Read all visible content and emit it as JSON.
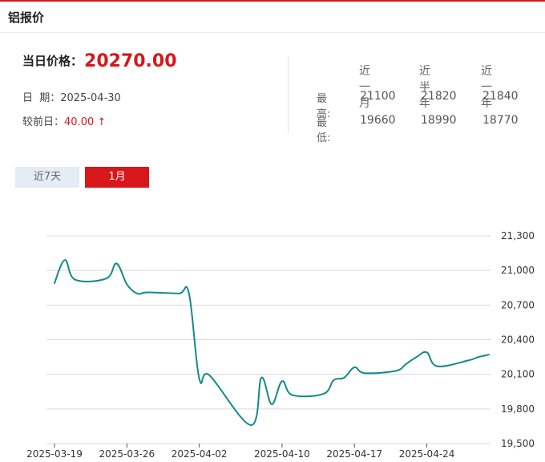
{
  "header": {
    "title": "铝报价"
  },
  "summary": {
    "price_label": "当日价格：",
    "price": "20270.00",
    "date_label": "日  期：",
    "date": "2025-04-30",
    "change_label": "较前日：",
    "change": "40.00 ↑"
  },
  "stats": {
    "columns": [
      "近一月",
      "近半年",
      "近一年"
    ],
    "high_label": "最高:",
    "low_label": "最低:",
    "high": [
      "21100",
      "21820",
      "21840"
    ],
    "low": [
      "19660",
      "18990",
      "18770"
    ]
  },
  "tabs": [
    {
      "label": "近7天",
      "active": false
    },
    {
      "label": "1月",
      "active": true
    }
  ],
  "colors": {
    "accent": "#d7171a",
    "line": "#138a8a",
    "grid": "#d9d9d9"
  },
  "chart_data": {
    "type": "line",
    "title": "",
    "xlabel": "",
    "ylabel": "",
    "ylim": [
      19500,
      21300
    ],
    "y_ticks": [
      19500,
      19800,
      20100,
      20400,
      20700,
      21000,
      21300
    ],
    "y_tick_labels": [
      "19,500",
      "19,800",
      "20,100",
      "20,400",
      "20,700",
      "21,000",
      "21,300"
    ],
    "x_ticks": [
      "2025-03-19",
      "2025-03-26",
      "2025-04-02",
      "2025-04-10",
      "2025-04-17",
      "2025-04-24"
    ],
    "grid": true,
    "legend": "none",
    "x": [
      "2025-03-19",
      "2025-03-20",
      "2025-03-21",
      "2025-03-24",
      "2025-03-25",
      "2025-03-26",
      "2025-03-27",
      "2025-03-28",
      "2025-03-31",
      "2025-04-01",
      "2025-04-02",
      "2025-04-03",
      "2025-04-07",
      "2025-04-08",
      "2025-04-09",
      "2025-04-10",
      "2025-04-11",
      "2025-04-14",
      "2025-04-15",
      "2025-04-16",
      "2025-04-17",
      "2025-04-18",
      "2025-04-21",
      "2025-04-22",
      "2025-04-23",
      "2025-04-24",
      "2025-04-25",
      "2025-04-28",
      "2025-04-29",
      "2025-04-30"
    ],
    "series": [
      {
        "values": [
          20890,
          21090,
          20920,
          20930,
          21060,
          20880,
          20800,
          20810,
          20800,
          20800,
          20060,
          20090,
          19660,
          20070,
          19840,
          20040,
          19920,
          19930,
          20050,
          20070,
          20160,
          20110,
          20130,
          20190,
          20250,
          20290,
          20170,
          20220,
          20250,
          20270
        ]
      }
    ]
  }
}
